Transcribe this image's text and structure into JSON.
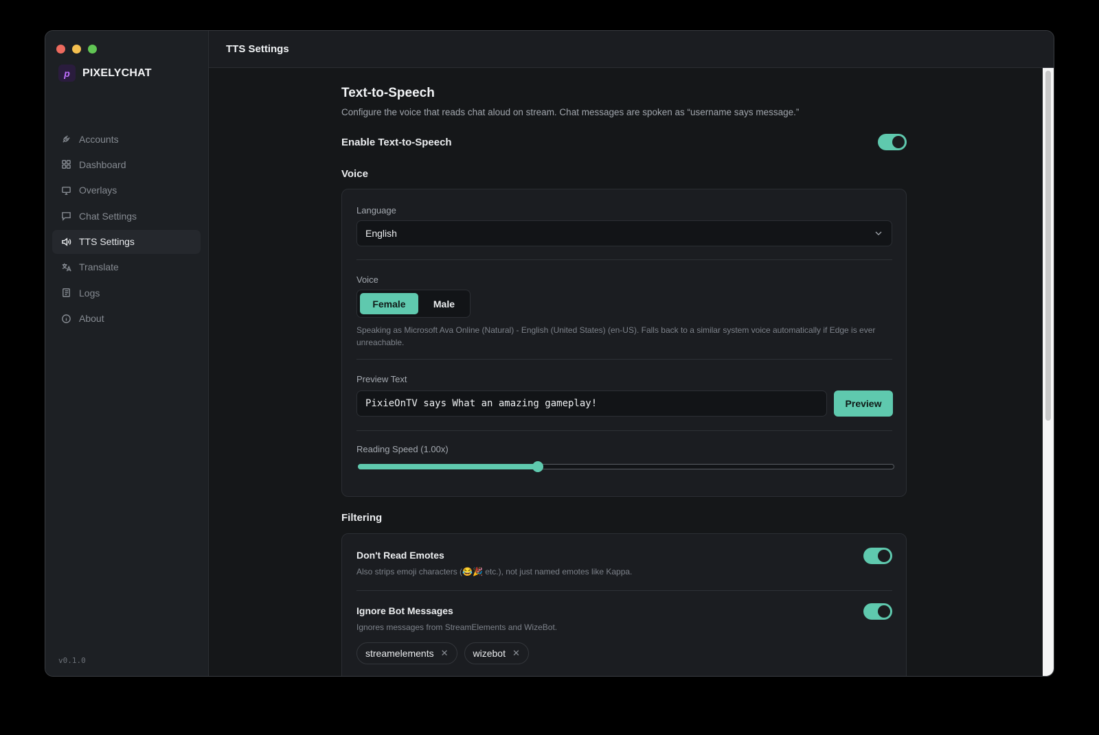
{
  "app": {
    "name": "PIXELYCHAT",
    "version": "v0.1.0"
  },
  "sidebar": {
    "items": [
      {
        "label": "Accounts",
        "icon": "plug-icon",
        "active": false
      },
      {
        "label": "Dashboard",
        "icon": "grid-icon",
        "active": false
      },
      {
        "label": "Overlays",
        "icon": "monitor-icon",
        "active": false
      },
      {
        "label": "Chat Settings",
        "icon": "chat-icon",
        "active": false
      },
      {
        "label": "TTS Settings",
        "icon": "speaker-icon",
        "active": true
      },
      {
        "label": "Translate",
        "icon": "translate-icon",
        "active": false
      },
      {
        "label": "Logs",
        "icon": "logs-icon",
        "active": false
      },
      {
        "label": "About",
        "icon": "info-icon",
        "active": false
      }
    ]
  },
  "header": {
    "title": "TTS Settings"
  },
  "tts": {
    "title": "Text-to-Speech",
    "description": "Configure the voice that reads chat aloud on stream. Chat messages are spoken as “username says message.”",
    "enable_label": "Enable Text-to-Speech",
    "enabled": true
  },
  "voice_section": {
    "title": "Voice",
    "language_label": "Language",
    "language_value": "English",
    "voice_label": "Voice",
    "voice_options": [
      "Female",
      "Male"
    ],
    "voice_selected": "Female",
    "voice_hint": "Speaking as Microsoft Ava Online (Natural) - English (United States) (en-US). Falls back to a similar system voice automatically if Edge is ever unreachable.",
    "preview_label": "Preview Text",
    "preview_value": "PixieOnTV says What an amazing gameplay!",
    "preview_button": "Preview",
    "speed_label": "Reading Speed (1.00x)",
    "speed_fraction": 0.336
  },
  "filtering": {
    "title": "Filtering",
    "emotes_title": "Don't Read Emotes",
    "emotes_desc": "Also strips emoji characters (😂🎉 etc.), not just named emotes like Kappa.",
    "emotes_enabled": true,
    "bots_title": "Ignore Bot Messages",
    "bots_desc": "Ignores messages from StreamElements and WizeBot.",
    "bots_enabled": true,
    "bot_chips": [
      "streamelements",
      "wizebot"
    ]
  },
  "colors": {
    "accent": "#5fc9ae",
    "background": "#151719",
    "sidebar": "#1d2024"
  }
}
